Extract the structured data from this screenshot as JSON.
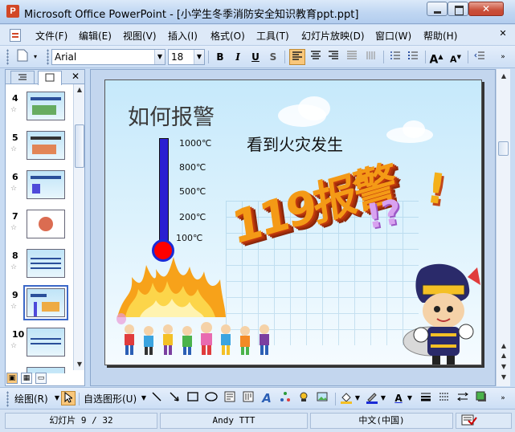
{
  "window": {
    "title": "Microsoft Office PowerPoint - [小学生冬季消防安全知识教育ppt.ppt]",
    "app_icon_letter": "P",
    "min_glyph": "",
    "max_glyph": "",
    "close_glyph": "✕"
  },
  "menu": {
    "items": [
      "文件(F)",
      "编辑(E)",
      "视图(V)",
      "插入(I)",
      "格式(O)",
      "工具(T)",
      "幻灯片放映(D)",
      "窗口(W)",
      "帮助(H)"
    ],
    "close_glyph": "✕"
  },
  "format_toolbar": {
    "font_name": "Arial",
    "font_size": "18",
    "bold": "B",
    "italic": "I",
    "underline": "U",
    "shadow": "S",
    "grow_font": "A",
    "shrink_font": "A"
  },
  "slides_pane": {
    "tab_outline_icon": "outline-tab-icon",
    "tab_slides_icon": "slides-tab-icon",
    "close_glyph": "✕",
    "star": "☆",
    "thumbnails": [
      {
        "number": "4",
        "selected": false
      },
      {
        "number": "5",
        "selected": false
      },
      {
        "number": "6",
        "selected": false
      },
      {
        "number": "7",
        "selected": false
      },
      {
        "number": "8",
        "selected": false
      },
      {
        "number": "9",
        "selected": true
      },
      {
        "number": "10",
        "selected": false
      }
    ]
  },
  "slide": {
    "title": "如何报警",
    "subtitle": "看到火灾发生",
    "big_text": "119报警",
    "exclamation": "!",
    "question_marks": "!?",
    "thermometer_labels": [
      "1000℃",
      "800℃",
      "500℃",
      "200℃",
      "100℃"
    ]
  },
  "draw_toolbar": {
    "draw_label": "绘图(R)",
    "autoshapes_label": "自选图形(U)"
  },
  "status": {
    "slide_counter": "幻灯片 9 / 32",
    "template": "Andy TTT",
    "language": "中文(中国)"
  },
  "colors": {
    "title_bar": "#bfd6f2",
    "menu_bar": "#dde9f8",
    "thermometer": "#2a1fd1",
    "bulb": "#ff0000",
    "big_text": "#f49a16"
  }
}
